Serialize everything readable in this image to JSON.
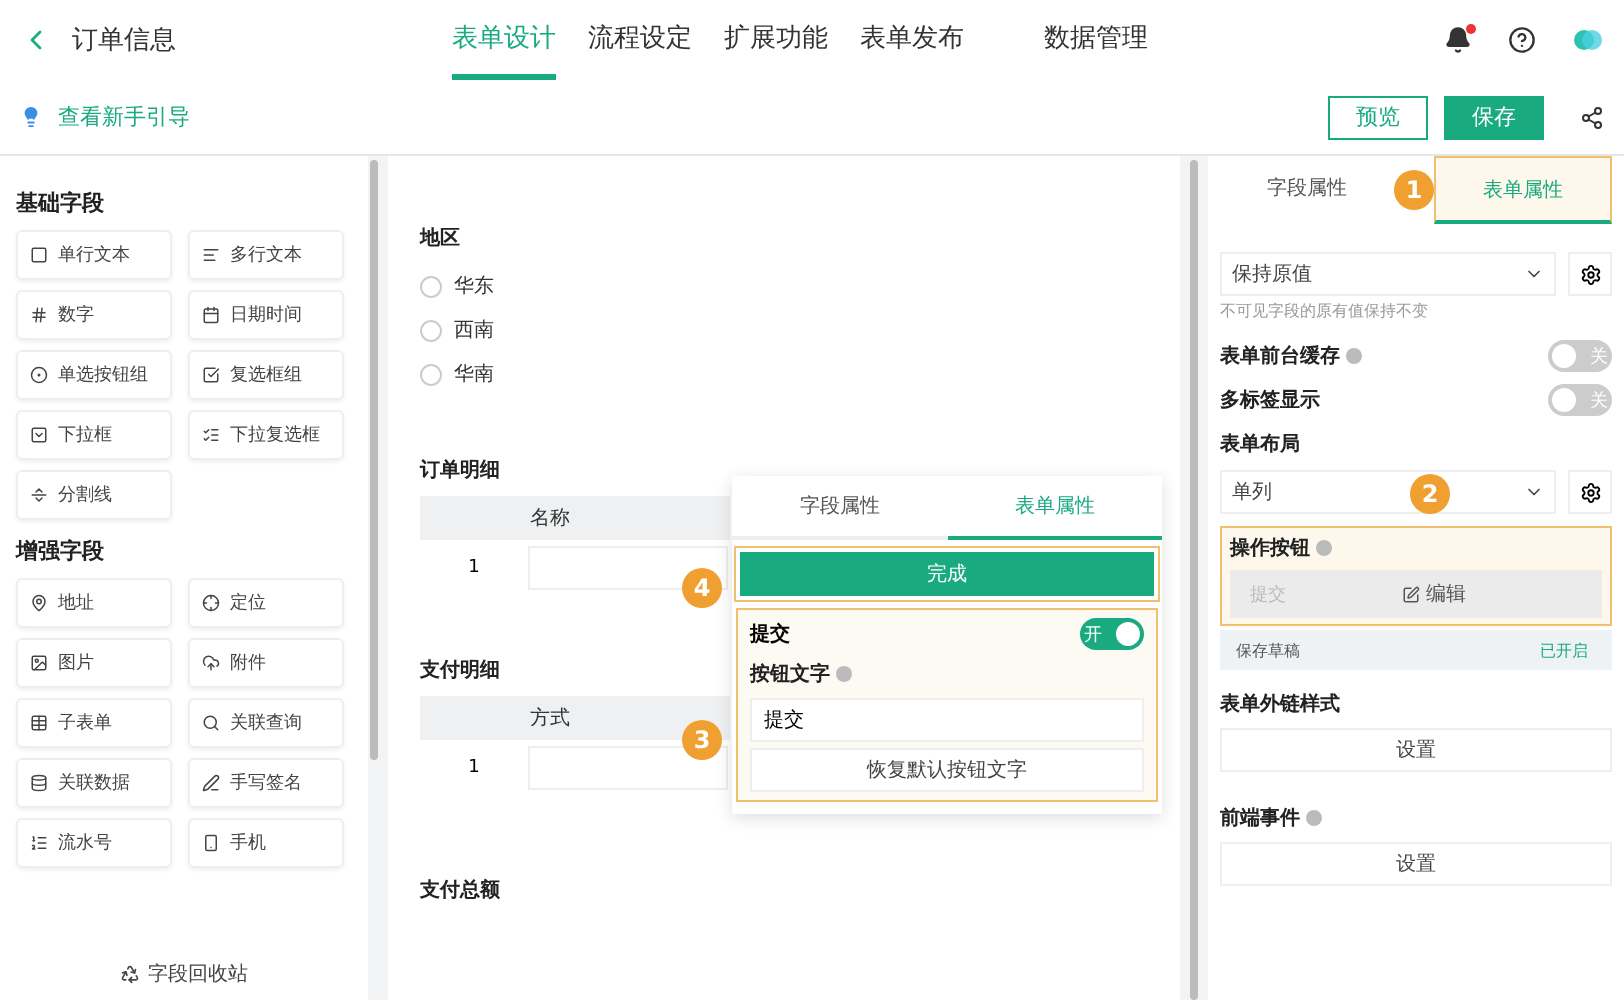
{
  "header": {
    "title": "订单信息",
    "nav": [
      {
        "label": "表单设计",
        "selected": true
      },
      {
        "label": "流程设定",
        "selected": false
      },
      {
        "label": "扩展功能",
        "selected": false
      },
      {
        "label": "表单发布",
        "selected": false
      },
      {
        "label": "数据管理",
        "selected": false
      }
    ],
    "notification_dot": true
  },
  "subheader": {
    "guide_link": "查看新手引导",
    "buttons": [
      {
        "label": "预览",
        "kind": "outline"
      },
      {
        "label": "保存",
        "kind": "primary"
      }
    ]
  },
  "sidebar": {
    "groups": [
      {
        "title": "基础字段",
        "items": [
          "单行文本",
          "多行文本",
          "数字",
          "日期时间",
          "单选按钮组",
          "复选框组",
          "下拉框",
          "下拉复选框",
          "分割线"
        ]
      },
      {
        "title": "增强字段",
        "items": [
          "地址",
          "定位",
          "图片",
          "附件",
          "子表单",
          "关联查询",
          "关联数据",
          "手写签名",
          "流水号",
          "手机"
        ]
      }
    ],
    "recycle": "字段回收站"
  },
  "canvas": {
    "radio_field": {
      "label": "地区",
      "options": [
        {
          "label": "华东",
          "selected": false
        },
        {
          "label": "西南",
          "selected": false
        },
        {
          "label": "华南",
          "selected": false
        }
      ]
    },
    "tables": [
      {
        "title": "订单明细",
        "column": "名称",
        "row": "1"
      },
      {
        "title": "支付明细",
        "column": "方式",
        "row": "1"
      }
    ],
    "total_label": "支付总额",
    "popup": {
      "tabs": [
        {
          "label": "字段属性",
          "selected": false
        },
        {
          "label": "表单属性",
          "selected": true
        }
      ],
      "done": "完成",
      "submit_label": "提交",
      "submit_on": true,
      "toggle_text": "开",
      "text_label": "按钮文字",
      "text_value": "提交",
      "reset": "恢复默认按钮文字"
    }
  },
  "properties": {
    "tabs": [
      {
        "label": "字段属性",
        "selected": false
      },
      {
        "label": "表单属性",
        "selected": true
      }
    ],
    "invisible_select": "保持原值",
    "invisible_hint": "不可见字段的原有值保持不变",
    "toggles": [
      {
        "label": "表单前台缓存",
        "help": true,
        "on": false,
        "text": "关"
      },
      {
        "label": "多标签显示",
        "help": false,
        "on": false,
        "text": "关"
      }
    ],
    "layout_label": "表单布局",
    "layout_select": "单列",
    "actions": {
      "label": "操作按钮",
      "left": "提交",
      "edit": "编辑",
      "draft": "保存草稿",
      "draft_status": "已开启"
    },
    "sections": [
      {
        "label": "表单外链样式",
        "help": false,
        "button": "设置"
      },
      {
        "label": "前端事件",
        "help": true,
        "button": "设置"
      }
    ]
  },
  "badges": [
    "1",
    "2",
    "3",
    "4"
  ]
}
